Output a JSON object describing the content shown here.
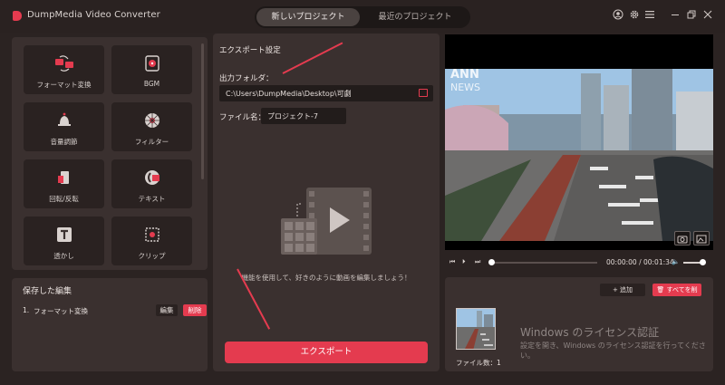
{
  "app": {
    "title": "DumpMedia Video Converter"
  },
  "tabs": {
    "new_project": "新しいプロジェクト",
    "recent_projects": "最近のプロジェクト"
  },
  "tools": [
    {
      "label": "フォーマット変換",
      "icon": "format-convert-icon"
    },
    {
      "label": "BGM",
      "icon": "music-icon"
    },
    {
      "label": "音量調節",
      "icon": "volume-bell-icon"
    },
    {
      "label": "フィルター",
      "icon": "filter-icon"
    },
    {
      "label": "回転/反転",
      "icon": "rotate-icon"
    },
    {
      "label": "テキスト",
      "icon": "text-icon"
    },
    {
      "label": "透かし",
      "icon": "watermark-icon"
    },
    {
      "label": "クリップ",
      "icon": "clip-icon"
    }
  ],
  "saved": {
    "title": "保存した編集",
    "items": [
      {
        "num": "1.",
        "name": "フォーマット変換",
        "edit": "編集",
        "delete": "削除"
      }
    ]
  },
  "export": {
    "title": "エクスポート設定",
    "output_folder_label": "出力フォルダ：",
    "output_path": "C:\\Users\\DumpMedia\\Desktop\\可劇",
    "filename_label": "ファイル名：",
    "filename_value": "プロジェクト-7",
    "hint": "機能を使用して、好きのように動画を編集しましょう！",
    "button": "エクスポート"
  },
  "player": {
    "timecode": "00:00:00 / 00:01:34",
    "progress": 0.0,
    "volume": 1.0,
    "overlay_text_1": "ANN",
    "overlay_text_2": "NEWS"
  },
  "files": {
    "add": "+ 追加",
    "delete_all": "すべてを削",
    "count": "ファイル数：1",
    "watermark_title": "Windows のライセンス認証",
    "watermark_sub": "設定を開き、Windows のライセンス認証を行ってくださ い。"
  },
  "colors": {
    "accent": "#e43b4f",
    "panel": "#3a302f",
    "background": "#2b2322"
  }
}
